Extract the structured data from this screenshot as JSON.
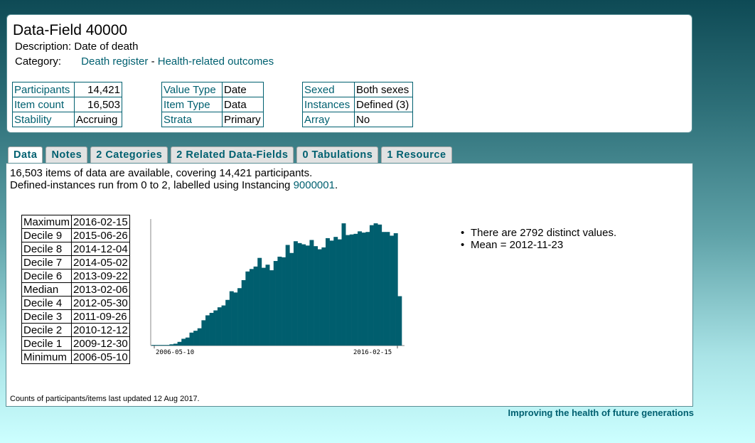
{
  "header": {
    "title": "Data-Field 40000",
    "description_label": "Description:",
    "description": "Date of death",
    "category_label": "Category:",
    "category_1": "Death register",
    "category_sep": "-",
    "category_2": "Health-related outcomes",
    "table1": [
      [
        "Participants",
        "14,421"
      ],
      [
        "Item count",
        "16,503"
      ],
      [
        "Stability",
        "Accruing"
      ]
    ],
    "table2": [
      [
        "Value Type",
        "Date"
      ],
      [
        "Item Type",
        "Data"
      ],
      [
        "Strata",
        "Primary"
      ]
    ],
    "table3": [
      [
        "Sexed",
        "Both sexes"
      ],
      [
        "Instances",
        "Defined (3)"
      ],
      [
        "Array",
        "No"
      ]
    ]
  },
  "tabs": [
    "Data",
    "Notes",
    "2 Categories",
    "2 Related Data-Fields",
    "0 Tabulations",
    "1 Resource"
  ],
  "content": {
    "summary_line1": "16,503 items of data are available, covering 14,421 participants.",
    "summary_line2_prefix": "Defined-instances run from 0 to 2, labelled using Instancing ",
    "instancing_link": "9000001",
    "summary_line2_suffix": ".",
    "deciles": [
      [
        "Maximum",
        "2016-02-15"
      ],
      [
        "Decile 9",
        "2015-06-26"
      ],
      [
        "Decile 8",
        "2014-12-04"
      ],
      [
        "Decile 7",
        "2014-05-02"
      ],
      [
        "Decile 6",
        "2013-09-22"
      ],
      [
        "Median",
        "2013-02-06"
      ],
      [
        "Decile 4",
        "2012-05-30"
      ],
      [
        "Decile 3",
        "2011-09-26"
      ],
      [
        "Decile 2",
        "2010-12-12"
      ],
      [
        "Decile 1",
        "2009-12-30"
      ],
      [
        "Minimum",
        "2006-05-10"
      ]
    ],
    "stats": [
      "There are 2792 distinct values.",
      "Mean = 2012-11-23"
    ],
    "footnote": "Counts of participants/items last updated 12 Aug 2017."
  },
  "footer": {
    "motto": "Improving the health of future generations"
  },
  "colors": {
    "accent": "#006070",
    "bar": "#005e6e"
  },
  "chart_data": {
    "type": "bar",
    "x_start_label": "2006-05-10",
    "x_end_label": "2016-02-15",
    "values": [
      1,
      1,
      1,
      1,
      1,
      1,
      1,
      1,
      1,
      2,
      2,
      3,
      3,
      6,
      6,
      11,
      11,
      13,
      13,
      21,
      21,
      24,
      24,
      28,
      28,
      41,
      41,
      49,
      49,
      53,
      53,
      57,
      57,
      62,
      62,
      65,
      65,
      74,
      74,
      88,
      88,
      86,
      86,
      93,
      93,
      106,
      106,
      120,
      120,
      124,
      124,
      128,
      128,
      142,
      142,
      126,
      126,
      131,
      131,
      122,
      122,
      137,
      137,
      144,
      144,
      143,
      143,
      163,
      163,
      150,
      150,
      169,
      169,
      166,
      166,
      164,
      164,
      162,
      162,
      171,
      171,
      161,
      161,
      156,
      156,
      159,
      159,
      174,
      174,
      170,
      170,
      176,
      176,
      172,
      172,
      198,
      198,
      179,
      179,
      180,
      180,
      181,
      181,
      185,
      185,
      183,
      183,
      184,
      184,
      195,
      195,
      198,
      198,
      196,
      196,
      184,
      184,
      184,
      184,
      178,
      178,
      182,
      182,
      80,
      80
    ],
    "ylim": [
      0,
      205
    ]
  }
}
